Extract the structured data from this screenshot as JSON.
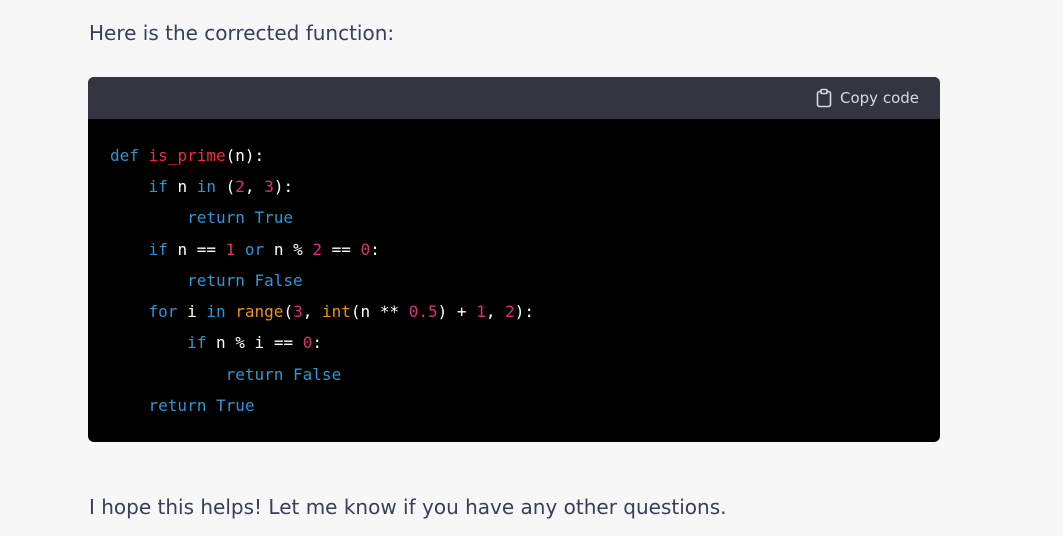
{
  "intro_text": "Here is the corrected function:",
  "code_header": {
    "copy_label": "Copy code",
    "icon": "clipboard-icon"
  },
  "code": {
    "language": "python",
    "lines": [
      "def is_prime(n):",
      "    if n in (2, 3):",
      "        return True",
      "    if n == 1 or n % 2 == 0:",
      "        return False",
      "    for i in range(3, int(n ** 0.5) + 1, 2):",
      "        if n % i == 0:",
      "            return False",
      "    return True"
    ]
  },
  "outro_text": "I hope this helps! Let me know if you have any other questions.",
  "colors": {
    "page_background": "#f7f7f8",
    "code_header_background": "#343541",
    "code_background": "#000000",
    "keyword": "#2e95d3",
    "function_name": "#f22c3d",
    "number": "#df3079",
    "builtin": "#e9950c"
  }
}
